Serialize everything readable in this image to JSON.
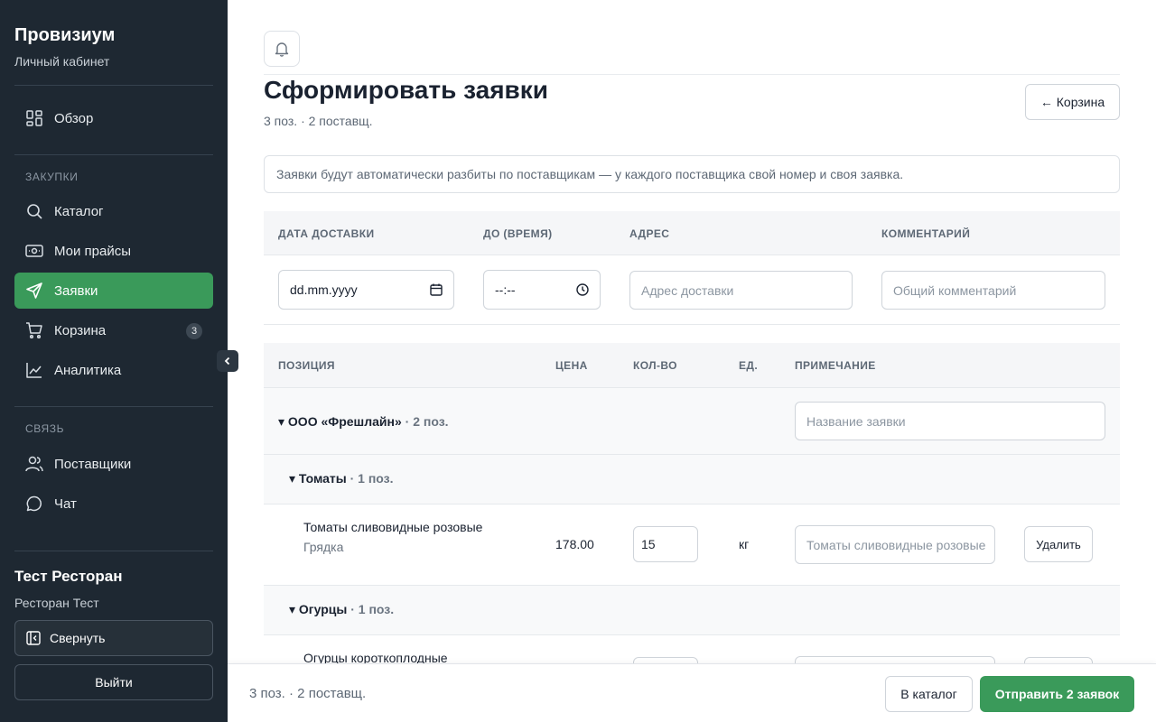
{
  "app": {
    "title": "Провизиум",
    "subtitle": "Личный кабинет"
  },
  "sidebar": {
    "overview": {
      "label": "Обзор",
      "icon": "grid-icon"
    },
    "section_purchases": "ЗАКУПКИ",
    "section_communication": "СВЯЗЬ",
    "items": [
      {
        "label": "Каталог",
        "icon": "search-icon"
      },
      {
        "label": "Мои прайсы",
        "icon": "price-tag-icon"
      },
      {
        "label": "Заявки",
        "icon": "send-icon",
        "active": true
      },
      {
        "label": "Корзина",
        "icon": "cart-icon",
        "badge": "3"
      },
      {
        "label": "Аналитика",
        "icon": "chart-icon"
      },
      {
        "label": "Поставщики",
        "icon": "users-icon"
      },
      {
        "label": "Чат",
        "icon": "chat-icon"
      }
    ],
    "org_name": "Тест Ресторан",
    "org_sub": "Ресторан Тест",
    "collapse_label": "Свернуть",
    "logout_label": "Выйти",
    "accent": "#3a9a5a"
  },
  "header": {
    "title": "Сформировать заявки",
    "summary": "3 поз. · 2 поставщ.",
    "back_label": "← Корзина"
  },
  "info_text": "Заявки будут автоматически разбиты по поставщикам — у каждого поставщика свой номер и своя заявка.",
  "delivery": {
    "headers": {
      "date": "ДАТА ДОСТАВКИ",
      "time": "ДО (ВРЕМЯ)",
      "address": "АДРЕС",
      "comment": "КОММЕНТАРИЙ"
    },
    "date_value": "dd.mm.yyyy",
    "time_value": "--:--",
    "address_placeholder": "Адрес доставки",
    "comment_placeholder": "Общий комментарий"
  },
  "items_table": {
    "headers": {
      "position": "ПОЗИЦИЯ",
      "price": "ЦЕНА",
      "qty": "КОЛ-ВО",
      "unit": "ЕД.",
      "note": "ПРИМЕЧАНИЕ"
    },
    "supplier": {
      "name": "▾ ООО «Фрешлайн»",
      "count": " · 2 поз.",
      "order_name_placeholder": "Название заявки"
    },
    "groups": [
      {
        "name": "▾ Томаты",
        "count": " · 1 поз.",
        "item": {
          "name": "Томаты сливовидные розовые",
          "supplier": "Грядка",
          "price": "178.00",
          "qty": "15",
          "unit": "кг",
          "note_placeholder": "Томаты сливовидные розовые",
          "delete_label": "Удалить"
        }
      },
      {
        "name": "▾ Огурцы",
        "count": " · 1 поз.",
        "item": {
          "name": "Огурцы короткоплодные"
        }
      }
    ]
  },
  "footer": {
    "summary": "3 поз. · 2 поставщ.",
    "catalog_label": "В каталог",
    "send_label": "Отправить 2 заявок"
  }
}
